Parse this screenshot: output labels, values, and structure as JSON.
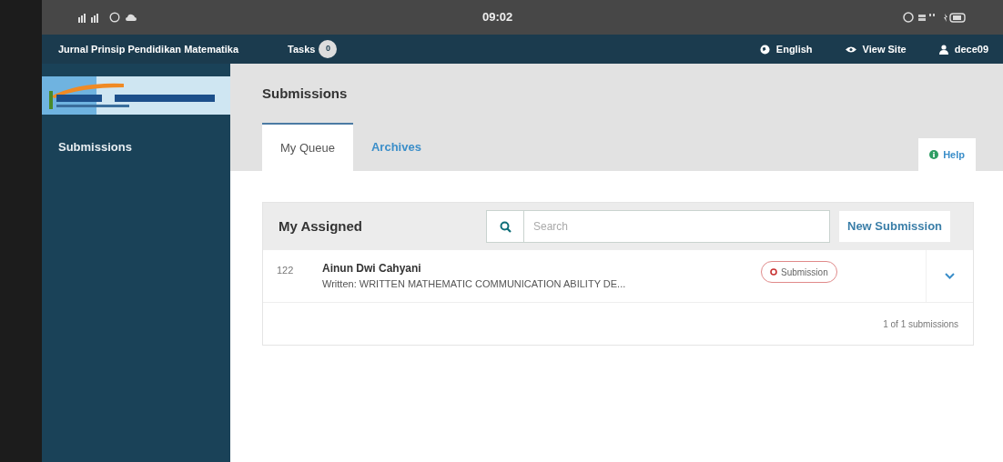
{
  "status_bar": {
    "time": "09:02"
  },
  "navbar": {
    "site_title": "Jurnal Prinsip Pendidikan Matematika",
    "tasks": {
      "label": "Tasks",
      "count": "0"
    },
    "links": [
      "English",
      "View Site",
      "dece09"
    ]
  },
  "sidebar": {
    "items": [
      {
        "label": "Submissions"
      }
    ]
  },
  "page": {
    "title": "Submissions",
    "tabs": [
      {
        "label": "My Queue",
        "selected": true
      },
      {
        "label": "Archives",
        "selected": false
      }
    ],
    "help": "Help",
    "panel": {
      "title": "My Assigned",
      "search": {
        "placeholder": "Search"
      },
      "new_button": "New Submission",
      "rows": [
        {
          "id": "122",
          "author": "Ainun Dwi Cahyani",
          "title": "Written: WRITTEN MATHEMATIC COMMUNICATION ABILITY DE...",
          "stage": "Submission"
        }
      ],
      "footer": "1 of 1 submissions"
    }
  }
}
